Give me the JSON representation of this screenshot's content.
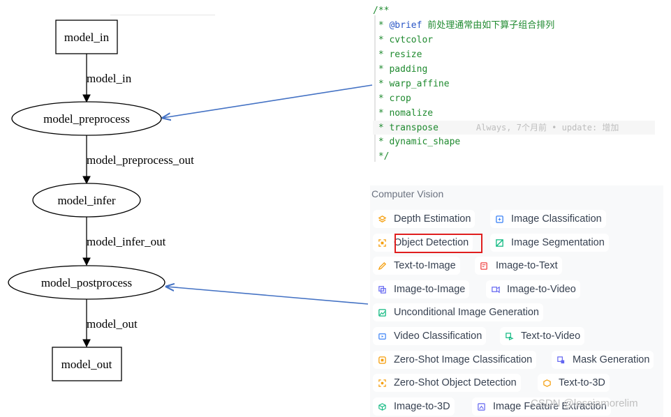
{
  "graph": {
    "nodes": [
      {
        "id": "model_in",
        "label": "model_in",
        "shape": "box"
      },
      {
        "id": "model_preprocess",
        "label": "model_preprocess",
        "shape": "ellipse"
      },
      {
        "id": "model_infer",
        "label": "model_infer",
        "shape": "ellipse"
      },
      {
        "id": "model_postprocess",
        "label": "model_postprocess",
        "shape": "ellipse"
      },
      {
        "id": "model_out",
        "label": "model_out",
        "shape": "box"
      }
    ],
    "edges": [
      {
        "from": "model_in",
        "to": "model_preprocess",
        "label": "model_in"
      },
      {
        "from": "model_preprocess",
        "to": "model_infer",
        "label": "model_preprocess_out"
      },
      {
        "from": "model_infer",
        "to": "model_postprocess",
        "label": "model_infer_out"
      },
      {
        "from": "model_postprocess",
        "to": "model_out",
        "label": "model_out"
      }
    ]
  },
  "code": {
    "lines": [
      {
        "text": "/**"
      },
      {
        "prefix": " * ",
        "keyword": "@brief",
        "text": " 前处理通常由如下算子组合排列"
      },
      {
        "text": " * cvtcolor"
      },
      {
        "text": " * resize"
      },
      {
        "text": " * padding"
      },
      {
        "text": " * warp_affine"
      },
      {
        "text": " * crop"
      },
      {
        "text": " * nomalize"
      },
      {
        "text": " * transpose",
        "blame": "Always, 7个月前 • update: 增加"
      },
      {
        "text": " * dynamic_shape"
      },
      {
        "text": " */"
      }
    ]
  },
  "cv_panel": {
    "title": "Computer Vision",
    "chips": [
      {
        "label": "Depth Estimation",
        "icon": "layers-icon",
        "color": "#f59e0b"
      },
      {
        "label": "Image Classification",
        "icon": "image-grid-icon",
        "color": "#3b82f6"
      },
      {
        "label": "Object Detection",
        "icon": "detect-box-icon",
        "color": "#f59e0b",
        "highlighted": true
      },
      {
        "label": "Image Segmentation",
        "icon": "segment-icon",
        "color": "#10b981"
      },
      {
        "label": "Text-to-Image",
        "icon": "pencil-image-icon",
        "color": "#f59e0b"
      },
      {
        "label": "Image-to-Text",
        "icon": "image-text-icon",
        "color": "#ef4444"
      },
      {
        "label": "Image-to-Image",
        "icon": "image-swap-icon",
        "color": "#6366f1"
      },
      {
        "label": "Image-to-Video",
        "icon": "image-video-icon",
        "color": "#6366f1"
      },
      {
        "label": "Unconditional Image Generation",
        "icon": "image-gen-icon",
        "color": "#10b981"
      },
      {
        "label": "Video Classification",
        "icon": "video-class-icon",
        "color": "#3b82f6"
      },
      {
        "label": "Text-to-Video",
        "icon": "text-video-icon",
        "color": "#10b981"
      },
      {
        "label": "Zero-Shot Image Classification",
        "icon": "zero-shot-image-icon",
        "color": "#f59e0b"
      },
      {
        "label": "Mask Generation",
        "icon": "mask-icon",
        "color": "#6366f1"
      },
      {
        "label": "Zero-Shot Object Detection",
        "icon": "zero-shot-detect-icon",
        "color": "#f59e0b"
      },
      {
        "label": "Text-to-3D",
        "icon": "cube-text-icon",
        "color": "#f59e0b"
      },
      {
        "label": "Image-to-3D",
        "icon": "cube-image-icon",
        "color": "#10b981"
      },
      {
        "label": "Image Feature Extraction",
        "icon": "feature-icon",
        "color": "#6366f1"
      }
    ]
  },
  "watermark": "CSDN @lessiamorelim",
  "colors": {
    "arrow_blue": "#4472c4",
    "highlight_red": "#e01e1e",
    "code_green": "#1f8a2f"
  }
}
